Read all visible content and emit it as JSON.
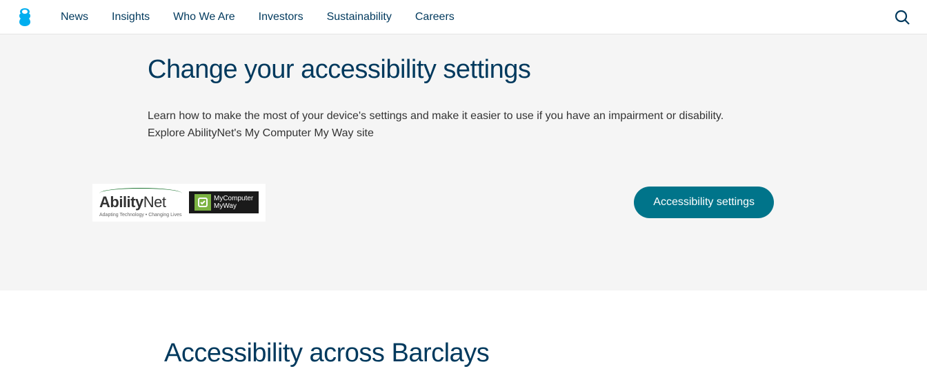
{
  "nav": {
    "items": [
      {
        "label": "News"
      },
      {
        "label": "Insights"
      },
      {
        "label": "Who We Are"
      },
      {
        "label": "Investors"
      },
      {
        "label": "Sustainability"
      },
      {
        "label": "Careers"
      }
    ]
  },
  "section1": {
    "heading": "Change your accessibility settings",
    "description_line1": "Learn how to make the most of your device's settings and make it easier to use if you have an impairment or disability.",
    "description_line2": "Explore AbilityNet's My Computer My Way site",
    "partner": {
      "ability_bold": "Ability",
      "ability_light": "Net",
      "ability_tag": "Adapting Technology • Changing Lives",
      "mcmw_line1": "MyComputer",
      "mcmw_line2": "MyWay"
    },
    "cta_label": "Accessibility settings"
  },
  "section2": {
    "heading": "Accessibility across Barclays"
  }
}
